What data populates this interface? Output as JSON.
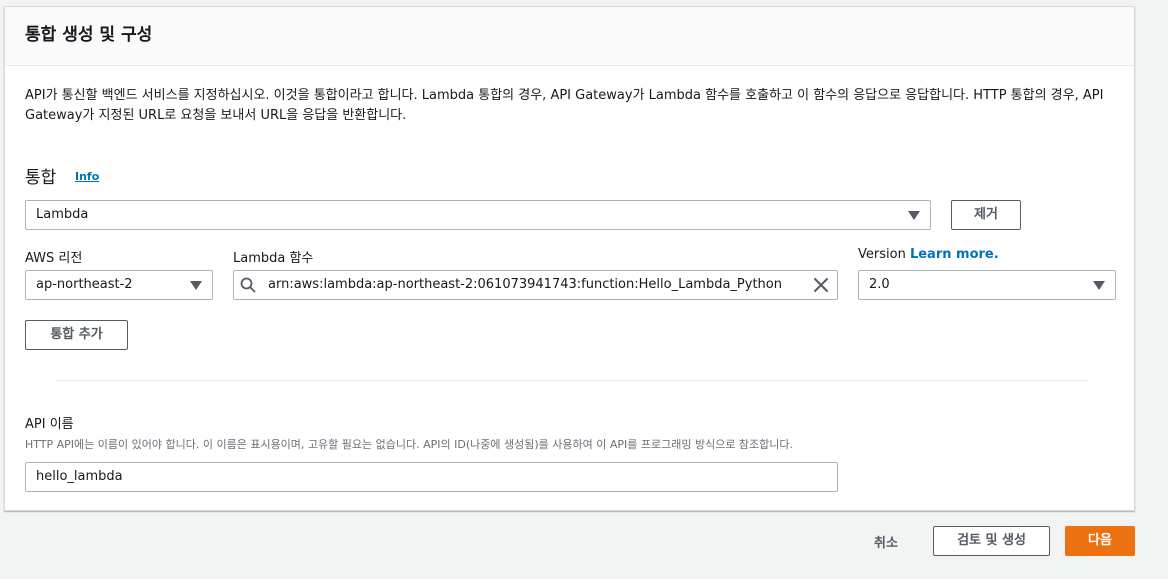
{
  "panel": {
    "title": "통합 생성 및 구성",
    "description": "API가 통신할 백엔드 서비스를 지정하십시오. 이것을 통합이라고 합니다. Lambda 통합의 경우, API Gateway가 Lambda 함수를 호출하고 이 함수의 응답으로 응답합니다. HTTP 통합의 경우, API Gateway가 지정된 URL로 요청을 보내서 URL을 응답을 반환합니다."
  },
  "integration": {
    "label": "통합",
    "info_link": "Info",
    "type_value": "Lambda",
    "remove_button": "제거",
    "region_label": "AWS 리전",
    "region_value": "ap-northeast-2",
    "function_label": "Lambda 함수",
    "function_value": "arn:aws:lambda:ap-northeast-2:061073941743:function:Hello_Lambda_Python",
    "version_label": "Version",
    "version_learn_more": "Learn more.",
    "version_value": "2.0",
    "add_button": "통합 추가"
  },
  "api_name": {
    "label": "API 이름",
    "hint": "HTTP API에는 이름이 있어야 합니다. 이 이름은 표시용이며, 고유할 필요는 없습니다. API의 ID(나중에 생성됨)를 사용하여 이 API를 프로그래밍 방식으로 참조합니다.",
    "value": "hello_lambda"
  },
  "footer": {
    "cancel": "취소",
    "review": "검토 및 생성",
    "next": "다음"
  },
  "icons": {
    "search": "search-icon",
    "clear": "close-icon",
    "dropdown": "caret-down-icon"
  },
  "colors": {
    "accent": "#ec7211",
    "link": "#0073bb",
    "background": "#f2f3f3"
  }
}
